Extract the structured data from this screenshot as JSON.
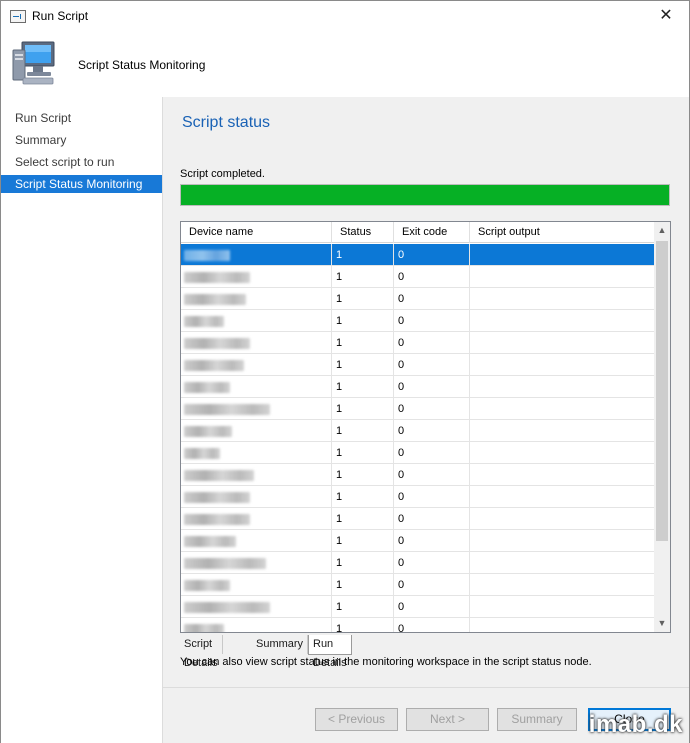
{
  "window": {
    "title": "Run Script"
  },
  "header": {
    "heading": "Script Status Monitoring"
  },
  "nav": {
    "items": [
      {
        "label": "Run Script",
        "active": false
      },
      {
        "label": "Summary",
        "active": false
      },
      {
        "label": "Select script to run",
        "active": false
      },
      {
        "label": "Script Status Monitoring",
        "active": true
      }
    ]
  },
  "content": {
    "title": "Script status",
    "progress_label": "Script completed.",
    "progress_fraction": 1.0,
    "progress_color": "#06b025"
  },
  "grid": {
    "columns": [
      "Device name",
      "Status",
      "Exit code",
      "Script output"
    ],
    "rows": [
      {
        "device": "",
        "status": "1",
        "exit_code": "0",
        "output": "",
        "selected": true
      },
      {
        "device": "",
        "status": "1",
        "exit_code": "0",
        "output": ""
      },
      {
        "device": "",
        "status": "1",
        "exit_code": "0",
        "output": ""
      },
      {
        "device": "",
        "status": "1",
        "exit_code": "0",
        "output": ""
      },
      {
        "device": "",
        "status": "1",
        "exit_code": "0",
        "output": ""
      },
      {
        "device": "",
        "status": "1",
        "exit_code": "0",
        "output": ""
      },
      {
        "device": "",
        "status": "1",
        "exit_code": "0",
        "output": ""
      },
      {
        "device": "",
        "status": "1",
        "exit_code": "0",
        "output": ""
      },
      {
        "device": "",
        "status": "1",
        "exit_code": "0",
        "output": ""
      },
      {
        "device": "",
        "status": "1",
        "exit_code": "0",
        "output": ""
      },
      {
        "device": "",
        "status": "1",
        "exit_code": "0",
        "output": ""
      },
      {
        "device": "",
        "status": "1",
        "exit_code": "0",
        "output": ""
      },
      {
        "device": "",
        "status": "1",
        "exit_code": "0",
        "output": ""
      },
      {
        "device": "",
        "status": "1",
        "exit_code": "0",
        "output": ""
      },
      {
        "device": "",
        "status": "1",
        "exit_code": "0",
        "output": ""
      },
      {
        "device": "",
        "status": "1",
        "exit_code": "0",
        "output": ""
      },
      {
        "device": "",
        "status": "1",
        "exit_code": "0",
        "output": ""
      },
      {
        "device": "",
        "status": "1",
        "exit_code": "0",
        "output": ""
      }
    ]
  },
  "tabs": [
    {
      "label": "Script Details",
      "active": false
    },
    {
      "label": "Summary",
      "active": false
    },
    {
      "label": "Run Details",
      "active": true
    }
  ],
  "hint": "You can also view script status in the monitoring workspace in the script status node.",
  "buttons": {
    "previous": "< Previous",
    "next": "Next >",
    "summary": "Summary",
    "close": "Close"
  },
  "watermark": "imab.dk"
}
